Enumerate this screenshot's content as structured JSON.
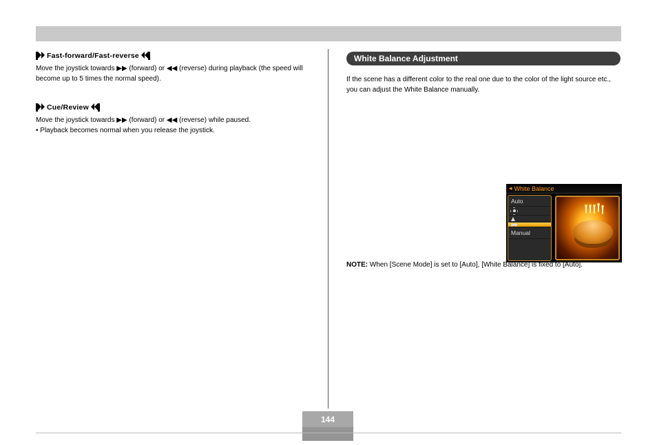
{
  "top_bar": {
    "title": ""
  },
  "left": {
    "sections": [
      {
        "title": "Fast-forward/Fast-reverse",
        "body": "Move the joystick towards ▶▶ (forward) or ◀◀ (reverse) during playback (the speed will become up to 5 times the normal speed).",
        "iconL": "fast-forward-icon",
        "iconR": "fast-reverse-icon"
      },
      {
        "title": "Cue/Review",
        "body": "Move the joystick towards ▶▶ (forward) or ◀◀ (reverse) while paused.\n• Playback becomes normal when you release the joystick.",
        "iconL": "fast-forward-icon",
        "iconR": "fast-reverse-icon"
      }
    ]
  },
  "right": {
    "header": "White Balance Adjustment",
    "intro": "If the scene has a different color to the real one due to the color of the light source etc., you can adjust the White Balance manually.",
    "note_label": "NOTE:",
    "note_body": "When [Scene Mode] is set to [Auto], [White Balance] is fixed to [Auto].",
    "menu": {
      "title": "White Balance",
      "items": [
        {
          "label": "Auto",
          "icon": "",
          "selected": false,
          "name": "wb-item-auto"
        },
        {
          "label": "",
          "icon": "sun-icon",
          "selected": false,
          "name": "wb-item-daylight"
        },
        {
          "label": "",
          "icon": "incandescent-icon",
          "selected": false,
          "name": "wb-item-incandescent"
        },
        {
          "label": "",
          "icon": "fluorescent-icon",
          "selected": true,
          "name": "wb-item-fluorescent"
        },
        {
          "label": "Manual",
          "icon": "",
          "selected": false,
          "name": "wb-item-manual"
        }
      ]
    }
  },
  "page_number": "144",
  "page_sub": ""
}
